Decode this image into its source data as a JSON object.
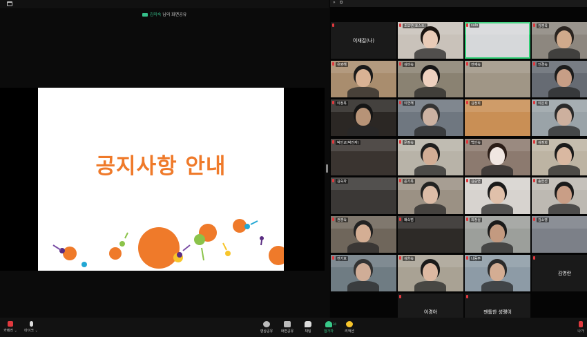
{
  "share_banner": {
    "presenter": "김미숙",
    "suffix": "님의 화면공유"
  },
  "slide": {
    "title": "공지사항 안내"
  },
  "right_topbar": {
    "collapse": "»",
    "popout": "⧉"
  },
  "participants": [
    {
      "name": "이재길(나)",
      "video": false,
      "row": 0,
      "col": 0
    },
    {
      "name": "조보연(호스트)",
      "video": true,
      "row": 0,
      "col": 1,
      "bg": "#c9c2ba",
      "face": "#e9cbb7",
      "hair": "#1a1410"
    },
    {
      "name": "sulo",
      "video": true,
      "row": 0,
      "col": 2,
      "bg": "#d6d8da",
      "face": "",
      "hair": "",
      "active": true
    },
    {
      "name": "김영욱",
      "video": true,
      "row": 0,
      "col": 3,
      "bg": "#8d877f",
      "face": "#d0aa8c",
      "hair": "#2a2420"
    },
    {
      "name": "유영해",
      "video": true,
      "row": 1,
      "col": 0,
      "bg": "#a98d6e",
      "face": "#d9b294",
      "hair": "#1a1a1a"
    },
    {
      "name": "김미숙",
      "video": true,
      "row": 1,
      "col": 1,
      "bg": "#8a8272",
      "face": "#eed1bf",
      "hair": "#151515"
    },
    {
      "name": "전재숙",
      "video": true,
      "row": 1,
      "col": 2,
      "bg": "#a09686",
      "face": "",
      "hair": ""
    },
    {
      "name": "인경숙",
      "video": true,
      "row": 1,
      "col": 3,
      "bg": "#666b73",
      "face": "#c79e86",
      "hair": "#1c1c1c"
    },
    {
      "name": "이정옥",
      "video": true,
      "row": 2,
      "col": 0,
      "bg": "#2b2724",
      "face": "#b79377",
      "hair": "#151515"
    },
    {
      "name": "이연해",
      "video": true,
      "row": 2,
      "col": 1,
      "bg": "#6f7780",
      "face": "#ccb2a2",
      "hair": "#333"
    },
    {
      "name": "김정희",
      "video": true,
      "row": 2,
      "col": 2,
      "bg": "#c98f55",
      "face": "",
      "hair": ""
    },
    {
      "name": "이은희",
      "video": true,
      "row": 2,
      "col": 3,
      "bg": "#9aa3a8",
      "face": "#cdb09e",
      "hair": "#2a2a2a"
    },
    {
      "name": "박인교(박진자)",
      "video": true,
      "row": 3,
      "col": 0,
      "bg": "#3a3430",
      "face": "",
      "hair": ""
    },
    {
      "name": "문정숙",
      "video": true,
      "row": 3,
      "col": 1,
      "bg": "#b8b3a8",
      "face": "#d2ad95",
      "hair": "#1e1e1e"
    },
    {
      "name": "백인숙",
      "video": true,
      "row": 3,
      "col": 2,
      "bg": "#8c7a6f",
      "face": "#f0e6e1",
      "hair": "#2b1d17"
    },
    {
      "name": "김정희",
      "video": true,
      "row": 3,
      "col": 3,
      "bg": "#bdb4a3",
      "face": "#d9b8a1",
      "hair": "#1b1b1b"
    },
    {
      "name": "김숙자",
      "video": true,
      "row": 4,
      "col": 0,
      "bg": "#3b3836",
      "face": "",
      "hair": ""
    },
    {
      "name": "윤기옥",
      "video": true,
      "row": 4,
      "col": 1,
      "bg": "#9b9184",
      "face": "#dcbca7",
      "hair": "#222"
    },
    {
      "name": "김승연",
      "video": true,
      "row": 4,
      "col": 2,
      "bg": "#d7d3cf",
      "face": "#e0c0aa",
      "hair": "#1a1a1a"
    },
    {
      "name": "송한선",
      "video": true,
      "row": 4,
      "col": 3,
      "bg": "#bdb9b2",
      "face": "#c99e86",
      "hair": "#1a1a1a"
    },
    {
      "name": "권영숙",
      "video": true,
      "row": 5,
      "col": 0,
      "bg": "#6f665b",
      "face": "#d4ae94",
      "hair": "#222"
    },
    {
      "name": "왜숙범",
      "video": true,
      "row": 5,
      "col": 1,
      "bg": "#2d2a27",
      "face": "",
      "hair": ""
    },
    {
      "name": "최정실",
      "video": true,
      "row": 5,
      "col": 2,
      "bg": "#9c9f9b",
      "face": "#c39a80",
      "hair": "#1a1a1a"
    },
    {
      "name": "김소영",
      "video": true,
      "row": 5,
      "col": 3,
      "bg": "#7c8088",
      "face": "",
      "hair": ""
    },
    {
      "name": "전기호",
      "video": true,
      "row": 6,
      "col": 0,
      "bg": "#6f7c83",
      "face": "#d0ad97",
      "hair": "#333"
    },
    {
      "name": "김한숙",
      "video": true,
      "row": 6,
      "col": 1,
      "bg": "#a9a294",
      "face": "#ddb9a2",
      "hair": "#1a1a1a"
    },
    {
      "name": "나동주",
      "video": true,
      "row": 6,
      "col": 2,
      "bg": "#8d9ba6",
      "face": "#d4ad93",
      "hair": "#2a2a2a"
    },
    {
      "name": "김영란",
      "video": false,
      "row": 6,
      "col": 3
    },
    {
      "name": "이경아",
      "video": false,
      "row": 7,
      "col": 1
    },
    {
      "name": "잰틀한 성쾡이",
      "video": false,
      "row": 7,
      "col": 2
    }
  ],
  "toolbar": {
    "left": [
      {
        "label": "카메라 ⌄",
        "icon": "camera-off-icon"
      },
      {
        "label": "마이크 ⌄",
        "icon": "mic-off-icon"
      }
    ],
    "center": [
      {
        "label": "영상공유",
        "icon": "video-share-icon"
      },
      {
        "label": "화면공유",
        "icon": "screen-share-icon"
      },
      {
        "label": "채팅",
        "icon": "chat-icon"
      },
      {
        "label": "참가자",
        "icon": "participants-icon",
        "count": "30"
      },
      {
        "label": "리액션",
        "icon": "reaction-icon"
      }
    ],
    "leave": {
      "label": "나가"
    }
  },
  "colors": {
    "accent_green": "#2fcf75",
    "slide_orange": "#ef7a2a",
    "leave_red": "#e0393e"
  }
}
